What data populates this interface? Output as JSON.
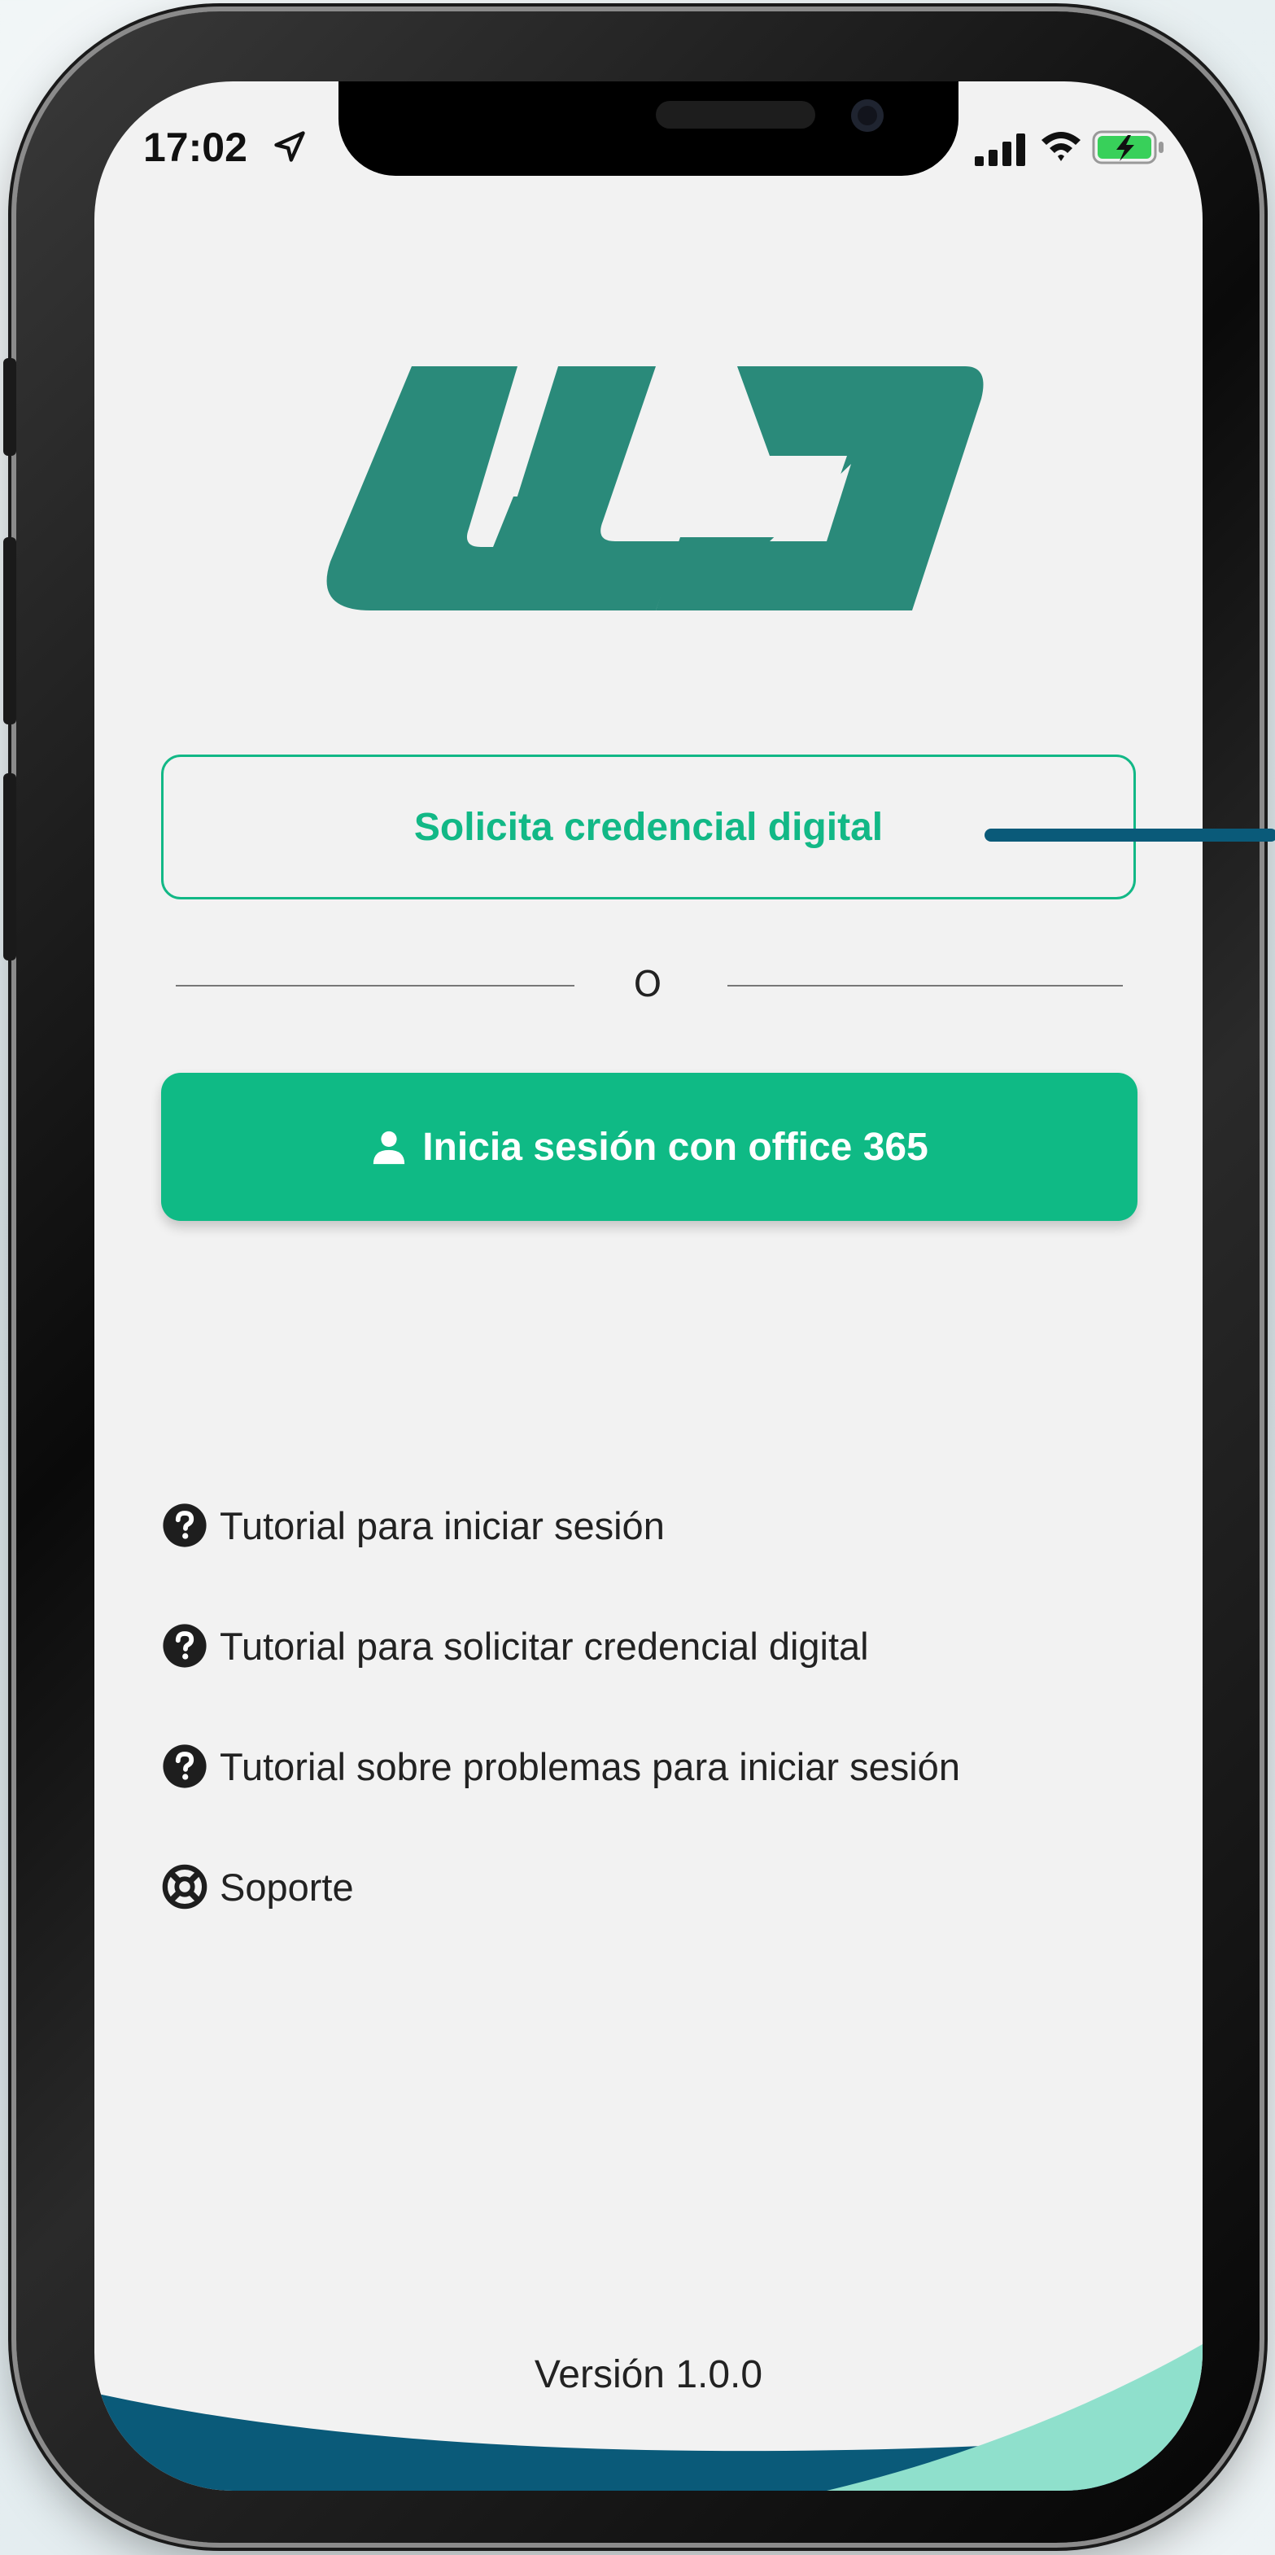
{
  "status_bar": {
    "time": "17:02"
  },
  "logo": {
    "text": "ULA",
    "color": "#2a8a7a"
  },
  "request_button": {
    "label": "Solicita credencial digital"
  },
  "divider": {
    "text": "O"
  },
  "login_button": {
    "label": "Inicia sesión con office 365"
  },
  "links": [
    {
      "label": "Tutorial para iniciar sesión"
    },
    {
      "label": "Tutorial para solicitar credencial digital"
    },
    {
      "label": "Tutorial sobre problemas para iniciar sesión"
    },
    {
      "label": "Soporte"
    }
  ],
  "footer": {
    "version": "Versión 1.0.0"
  },
  "colors": {
    "accent": "#0fba85",
    "logo": "#2a8a7a",
    "wave_dark": "#0a5a79",
    "wave_light": "#8fe0cc"
  }
}
